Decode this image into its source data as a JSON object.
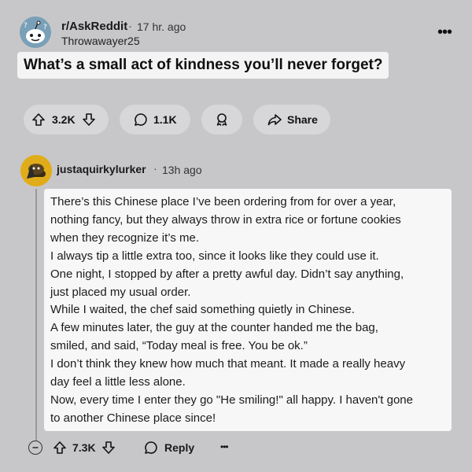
{
  "post": {
    "subreddit": "r/AskReddit",
    "time": "17 hr. ago",
    "author": "Throwawayer25",
    "title": "What’s a small act of kindness you’ll never forget?",
    "upvotes": "3.2K",
    "comments": "1.1K",
    "share_label": "Share"
  },
  "comment": {
    "username": "justaquirkylurker",
    "time": "13h ago",
    "lines": [
      "There’s this Chinese place I’ve been ordering from for over a year,",
      "nothing fancy, but they always throw in extra rice or fortune cookies",
      "when they recognize it’s me.",
      "I always tip a little extra too, since it looks like they could use it.",
      "One night, I stopped by after a pretty awful day. Didn’t say anything,",
      "just placed my usual order.",
      "While I waited, the chef said something quietly in Chinese.",
      "A few minutes later, the guy at the counter handed me the bag,",
      "smiled, and said, “Today meal is free. You be ok.”",
      "I don’t think they knew how much that meant. It made a really heavy",
      "day feel a little less alone.",
      "Now, every time I enter they go \"He smiling!\" all happy. I haven't gone",
      "to another Chinese place since!"
    ],
    "upvotes": "7.3K",
    "reply_label": "Reply"
  },
  "separators": {
    "dot": "·",
    "more": "•••"
  },
  "icons": {
    "post_more": "more-horizontal-icon",
    "upvote": "arrow-up-icon",
    "downvote": "arrow-down-icon",
    "comment": "speech-bubble-icon",
    "award": "award-icon",
    "share": "share-arrow-icon",
    "collapse": "minus-circle-icon",
    "reply": "speech-bubble-icon",
    "comment_more": "more-horizontal-icon"
  },
  "colors": {
    "background": "#c7c7c9",
    "title_highlight": "#f4f4f4",
    "pill": "#d7d7d9",
    "snoo_avatar": "#7aa0b8",
    "comment_avatar": "#e0ac19"
  }
}
